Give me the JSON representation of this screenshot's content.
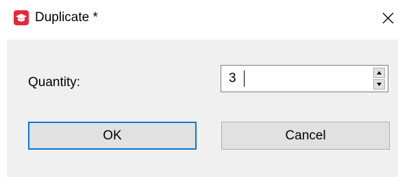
{
  "window": {
    "title": "Duplicate *",
    "app_icon": "graduation-cap-icon",
    "close_icon": "close-icon",
    "accent_color": "#e5273a",
    "focus_color": "#0078d7"
  },
  "form": {
    "quantity_label": "Quantity:",
    "quantity_value": "3",
    "spin_up_icon": "chevron-up-icon",
    "spin_down_icon": "chevron-down-icon"
  },
  "buttons": {
    "ok_label": "OK",
    "cancel_label": "Cancel"
  }
}
